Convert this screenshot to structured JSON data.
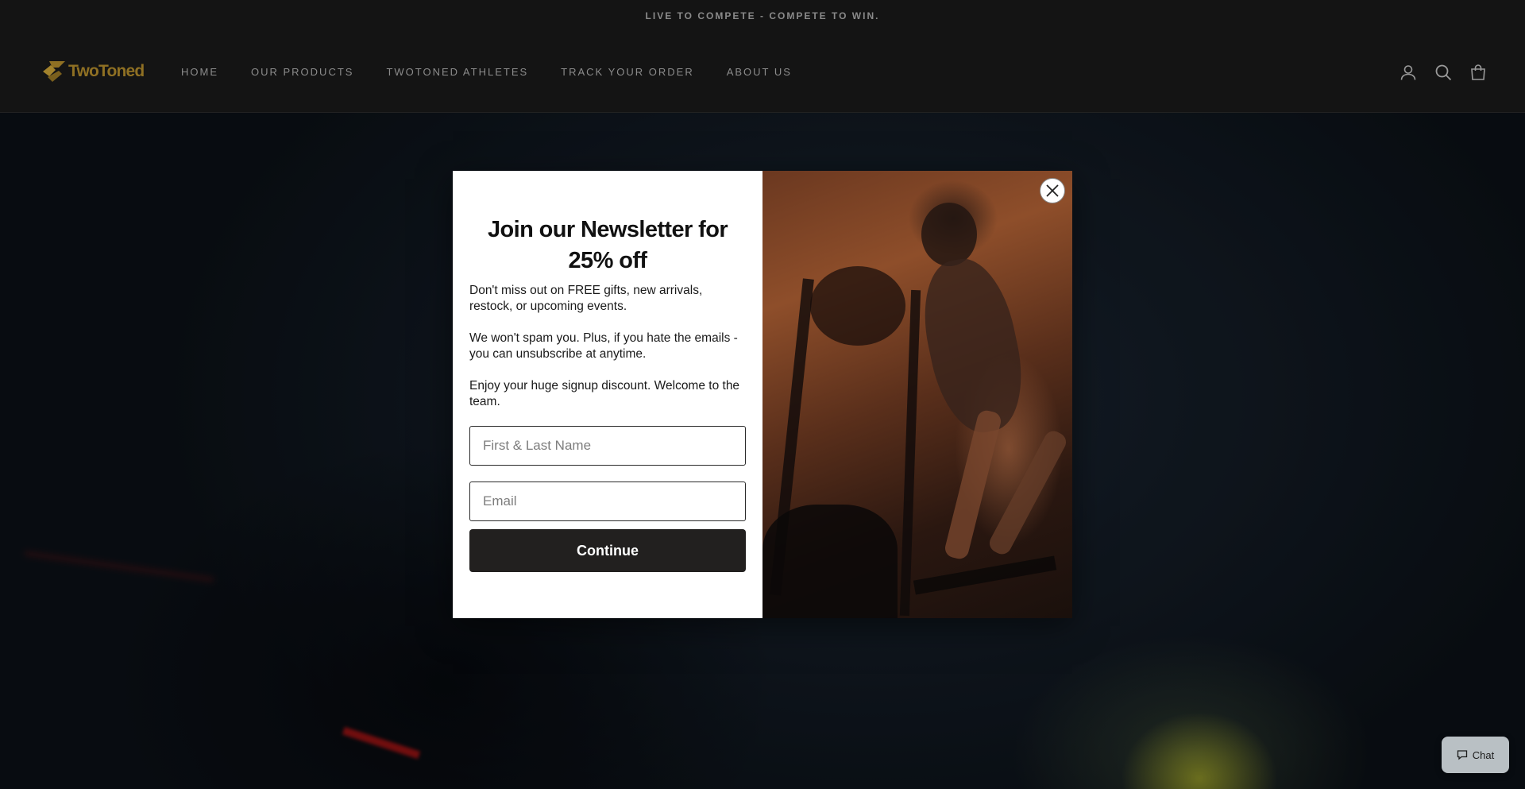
{
  "announcement": {
    "text": "LIVE TO COMPETE - COMPETE TO WIN."
  },
  "header": {
    "logo_text": "TwoToned",
    "nav": [
      {
        "label": "HOME"
      },
      {
        "label": "OUR PRODUCTS"
      },
      {
        "label": "TWOTONED ATHLETES"
      },
      {
        "label": "TRACK YOUR ORDER"
      },
      {
        "label": "ABOUT US"
      }
    ],
    "icons": [
      "account-icon",
      "search-icon",
      "cart-icon"
    ]
  },
  "modal": {
    "title": "Join our Newsletter for 25% off",
    "paragraphs": [
      "Don't miss out on FREE gifts, new arrivals, restock, or upcoming events.",
      "We won't spam you. Plus, if you hate the emails - you can unsubscribe at anytime.",
      "Enjoy your huge signup discount. Welcome to the team."
    ],
    "name_placeholder": "First & Last Name",
    "email_placeholder": "Email",
    "button_label": "Continue"
  },
  "chat": {
    "label": "Chat"
  },
  "colors": {
    "brand_gold": "#8f7023",
    "header_bg": "#141414",
    "button_dark": "#22201f"
  }
}
